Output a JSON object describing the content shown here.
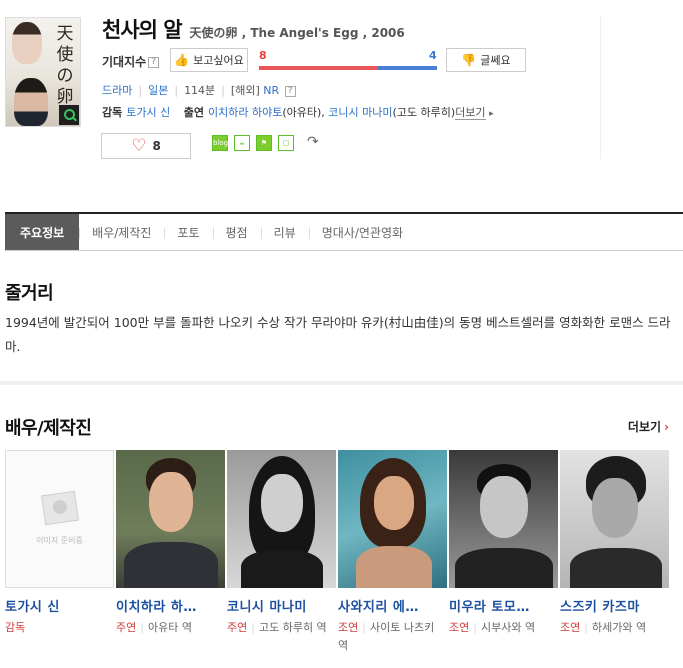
{
  "movie": {
    "title": "천사의 알",
    "subtitle": "天使の卵 , The Angel's Egg , 2006",
    "poster_title": "天使の卵"
  },
  "rating": {
    "label": "기대지수",
    "help": "?",
    "want_label": "보고싶어요",
    "meh_label": "글쎄요",
    "want_count": "8",
    "meh_count": "4",
    "want_ratio": 0.667,
    "colors": {
      "want": "#e8433d",
      "meh": "#3f78d4"
    }
  },
  "meta": {
    "genre": "드라마",
    "country": "일본",
    "runtime": "114분",
    "rating_prefix": "[해외]",
    "rating_value": "NR",
    "help": "?"
  },
  "credits": {
    "director_label": "감독",
    "director": "토가시 신",
    "cast_label": "출연",
    "actor1": "이치하라 하야토",
    "actor1_role": "(아유타),",
    "actor2": "코니시 마나미",
    "actor2_role": "(고도 하루히)",
    "more": "더보기"
  },
  "like": {
    "count": "8"
  },
  "share": {
    "items": [
      "blog",
      "",
      "",
      ""
    ]
  },
  "tabs": [
    {
      "label": "주요정보"
    },
    {
      "label": "배우/제작진"
    },
    {
      "label": "포토"
    },
    {
      "label": "평점"
    },
    {
      "label": "리뷰"
    },
    {
      "label": "명대사/연관영화"
    }
  ],
  "synopsis": {
    "title": "줄거리",
    "text": "1994년에 발간되어 100만 부를 돌파한 나오키 수상 작가 무라야마 유카(村山由佳)의 동명 베스트셀러를 영화화한 로맨스 드라마."
  },
  "cast_section": {
    "title": "배우/제작진",
    "more": "더보기",
    "noimage_text": "이미지 준비중",
    "people": [
      {
        "name": "토가시 신",
        "role_type": "감독",
        "role": ""
      },
      {
        "name": "이치하라 하…",
        "role_type": "주연",
        "role": "아유타 역"
      },
      {
        "name": "코니시 마나미",
        "role_type": "주연",
        "role": "고도 하루히 역"
      },
      {
        "name": "사와지리 에…",
        "role_type": "조연",
        "role": "사이토 나츠키 역"
      },
      {
        "name": "미우라 토모…",
        "role_type": "조연",
        "role": "시부사와 역"
      },
      {
        "name": "스즈키 카즈마",
        "role_type": "조연",
        "role": "하세가와 역"
      }
    ]
  }
}
